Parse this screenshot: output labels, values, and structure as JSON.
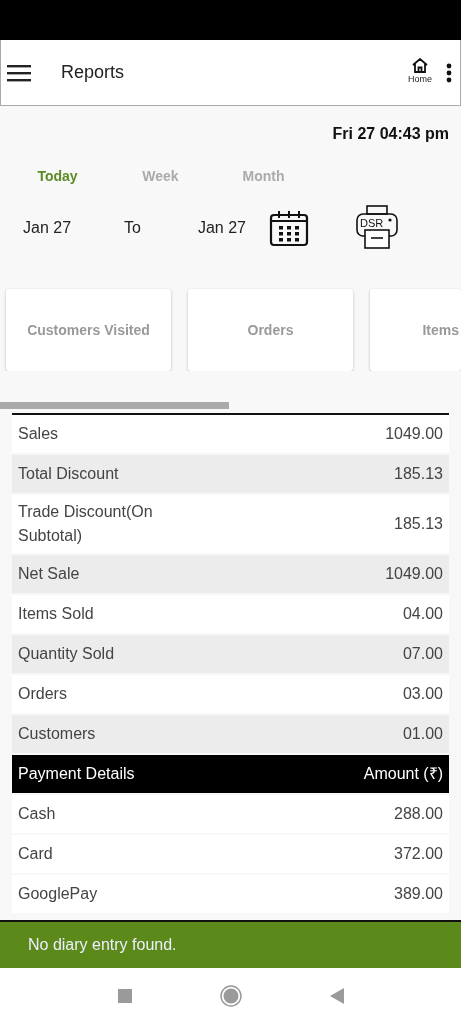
{
  "app_bar": {
    "title": "Reports",
    "home_label": "Home"
  },
  "datetime": "Fri 27 04:43 pm",
  "tabs": [
    {
      "label": "Today",
      "selected": true
    },
    {
      "label": "Week",
      "selected": false
    },
    {
      "label": "Month",
      "selected": false
    }
  ],
  "date_range": {
    "from": "Jan  27",
    "separator": "To",
    "to": "Jan  27",
    "print_label": "DSR"
  },
  "cards": [
    {
      "label": "Customers Visited"
    },
    {
      "label": "Orders"
    },
    {
      "label": "Items"
    }
  ],
  "summary_rows": [
    {
      "label": "Sales",
      "value": "1049.00"
    },
    {
      "label": "Total Discount",
      "value": "185.13"
    },
    {
      "label": "Trade Discount(On Subtotal)",
      "value": "185.13"
    },
    {
      "label": "Net Sale",
      "value": "1049.00"
    },
    {
      "label": "Items Sold",
      "value": "04.00"
    },
    {
      "label": "Quantity Sold",
      "value": "07.00"
    },
    {
      "label": "Orders",
      "value": "03.00"
    },
    {
      "label": "Customers",
      "value": "01.00"
    }
  ],
  "payment_header": {
    "label": "Payment Details",
    "amount": "Amount (₹)"
  },
  "payment_rows": [
    {
      "label": "Cash",
      "value": "288.00"
    },
    {
      "label": "Card",
      "value": "372.00"
    },
    {
      "label": "GooglePay",
      "value": "389.00"
    }
  ],
  "snackbar": "No diary entry found."
}
